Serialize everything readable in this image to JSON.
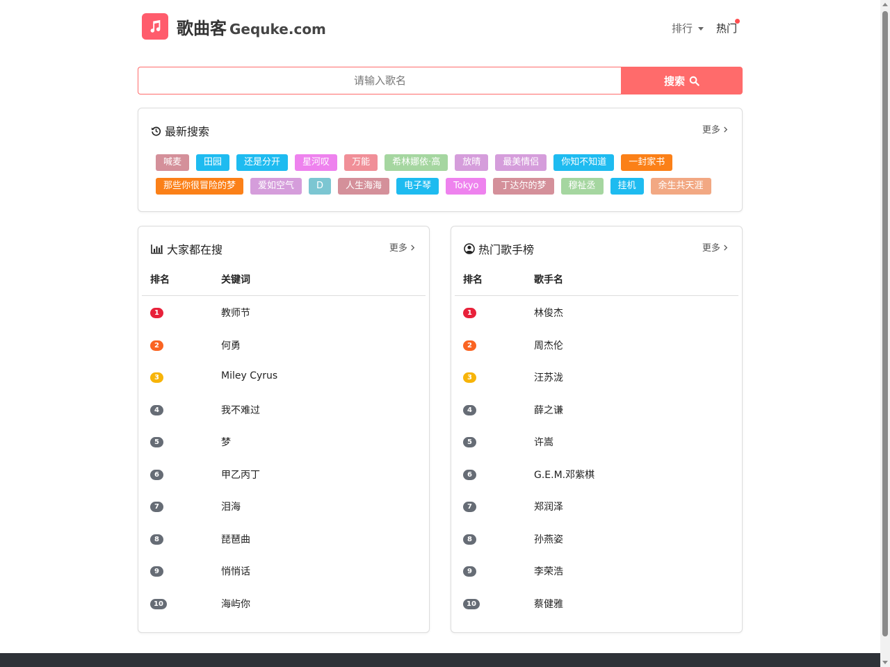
{
  "header": {
    "brand": "歌曲客",
    "domain": "Gequke.com",
    "nav_rank": "排行",
    "nav_hot": "热门"
  },
  "search": {
    "placeholder": "请输入歌名",
    "button_label": "搜索"
  },
  "recent": {
    "title": "最新搜索",
    "more": "更多",
    "tags": [
      {
        "text": "喊麦",
        "color": "#d4909a"
      },
      {
        "text": "田园",
        "color": "#1ebbf0"
      },
      {
        "text": "还是分开",
        "color": "#1ebbf0"
      },
      {
        "text": "星河叹",
        "color": "#ee82ee"
      },
      {
        "text": "万能",
        "color": "#f08f98"
      },
      {
        "text": "希林娜依·高",
        "color": "#a5d6a0"
      },
      {
        "text": "放晴",
        "color": "#d59ddb"
      },
      {
        "text": "最美情侣",
        "color": "#d59ddb"
      },
      {
        "text": "你知不知道",
        "color": "#1ebbf0"
      },
      {
        "text": "一封家书",
        "color": "#fb8018"
      },
      {
        "text": "那些你很冒险的梦",
        "color": "#fb8018"
      },
      {
        "text": "爱如空气",
        "color": "#d59ddb"
      },
      {
        "text": "D",
        "color": "#7cc6d2"
      },
      {
        "text": "人生海海",
        "color": "#d4909a"
      },
      {
        "text": "电子琴",
        "color": "#1ebbf0"
      },
      {
        "text": "Tokyo",
        "color": "#ee82ee"
      },
      {
        "text": "丁达尔的梦",
        "color": "#d4909a"
      },
      {
        "text": "穆祉丞",
        "color": "#a5d6a0"
      },
      {
        "text": "挂机",
        "color": "#1ebbf0"
      },
      {
        "text": "余生共天涯",
        "color": "#f2a883"
      }
    ]
  },
  "popular": {
    "title": "大家都在搜",
    "more": "更多",
    "col_rank": "排名",
    "col_name": "关键词",
    "rows": [
      {
        "rank": "1",
        "name": "教师节"
      },
      {
        "rank": "2",
        "name": "何勇"
      },
      {
        "rank": "3",
        "name": "Miley Cyrus"
      },
      {
        "rank": "4",
        "name": "我不难过"
      },
      {
        "rank": "5",
        "name": "梦"
      },
      {
        "rank": "6",
        "name": "甲乙丙丁"
      },
      {
        "rank": "7",
        "name": "泪海"
      },
      {
        "rank": "8",
        "name": "琵琶曲"
      },
      {
        "rank": "9",
        "name": "悄悄话"
      },
      {
        "rank": "10",
        "name": "海屿你"
      }
    ]
  },
  "singers": {
    "title": "热门歌手榜",
    "more": "更多",
    "col_rank": "排名",
    "col_name": "歌手名",
    "rows": [
      {
        "rank": "1",
        "name": "林俊杰"
      },
      {
        "rank": "2",
        "name": "周杰伦"
      },
      {
        "rank": "3",
        "name": "汪苏泷"
      },
      {
        "rank": "4",
        "name": "薛之谦"
      },
      {
        "rank": "5",
        "name": "许嵩"
      },
      {
        "rank": "6",
        "name": "G.E.M.邓紫棋"
      },
      {
        "rank": "7",
        "name": "郑润泽"
      },
      {
        "rank": "8",
        "name": "孙燕姿"
      },
      {
        "rank": "9",
        "name": "李荣浩"
      },
      {
        "rank": "10",
        "name": "蔡健雅"
      }
    ]
  },
  "colors": {
    "accent": "#ff6b6b",
    "logo": "#ff5c6c",
    "rank1": "#e8213a",
    "rank2": "#fa6422",
    "rank3": "#f7b409",
    "rank_default": "#666c75",
    "footer": "#2f3238"
  },
  "icons": {
    "logo": "music-note-icon",
    "search": "search-icon",
    "recent": "history-icon",
    "popular": "bar-chart-icon",
    "singers": "user-circle-icon"
  }
}
